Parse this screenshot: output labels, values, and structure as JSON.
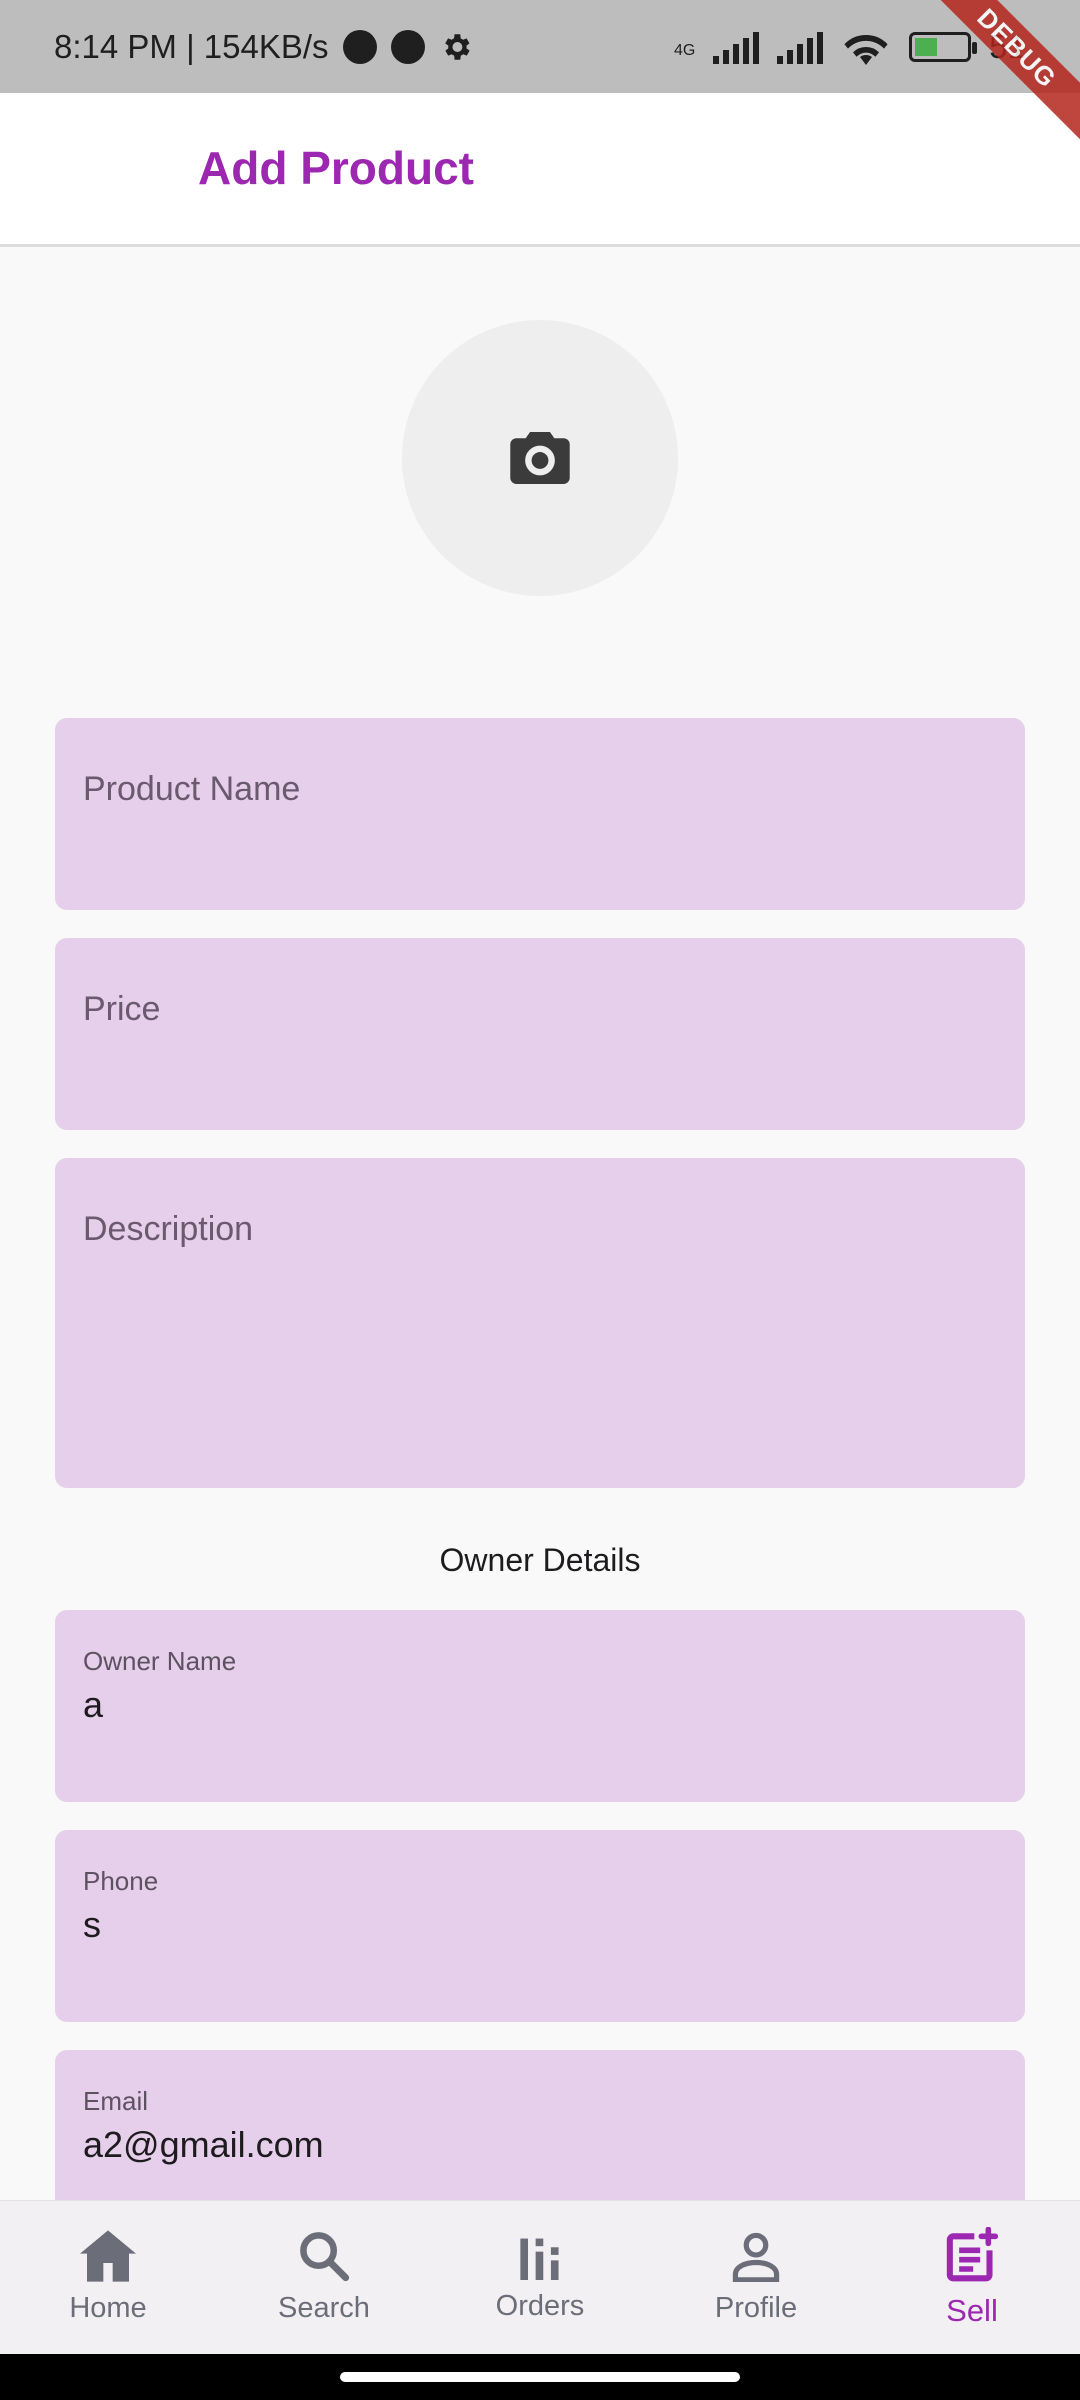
{
  "status_bar": {
    "time_and_speed": "8:14 PM | 154KB/s",
    "network": "4G",
    "battery_text": "51"
  },
  "debug_banner": "DEBUG",
  "app_bar": {
    "title": "Add Product"
  },
  "form": {
    "product_name_placeholder": "Product Name",
    "price_placeholder": "Price",
    "description_placeholder": "Description",
    "owner_section_title": "Owner Details",
    "owner_name": {
      "label": "Owner Name",
      "value": "a"
    },
    "phone": {
      "label": "Phone",
      "value": "s"
    },
    "email": {
      "label": "Email",
      "value": "a2@gmail.com"
    }
  },
  "bottom_nav": {
    "items": [
      {
        "label": "Home",
        "icon": "home-icon"
      },
      {
        "label": "Search",
        "icon": "search-icon"
      },
      {
        "label": "Orders",
        "icon": "orders-icon"
      },
      {
        "label": "Profile",
        "icon": "profile-icon"
      },
      {
        "label": "Sell",
        "icon": "sell-icon",
        "active": true
      }
    ]
  },
  "colors": {
    "accent": "#9c27b0",
    "field_bg": "#e6cfea",
    "nav_inactive": "#6b6e78"
  }
}
